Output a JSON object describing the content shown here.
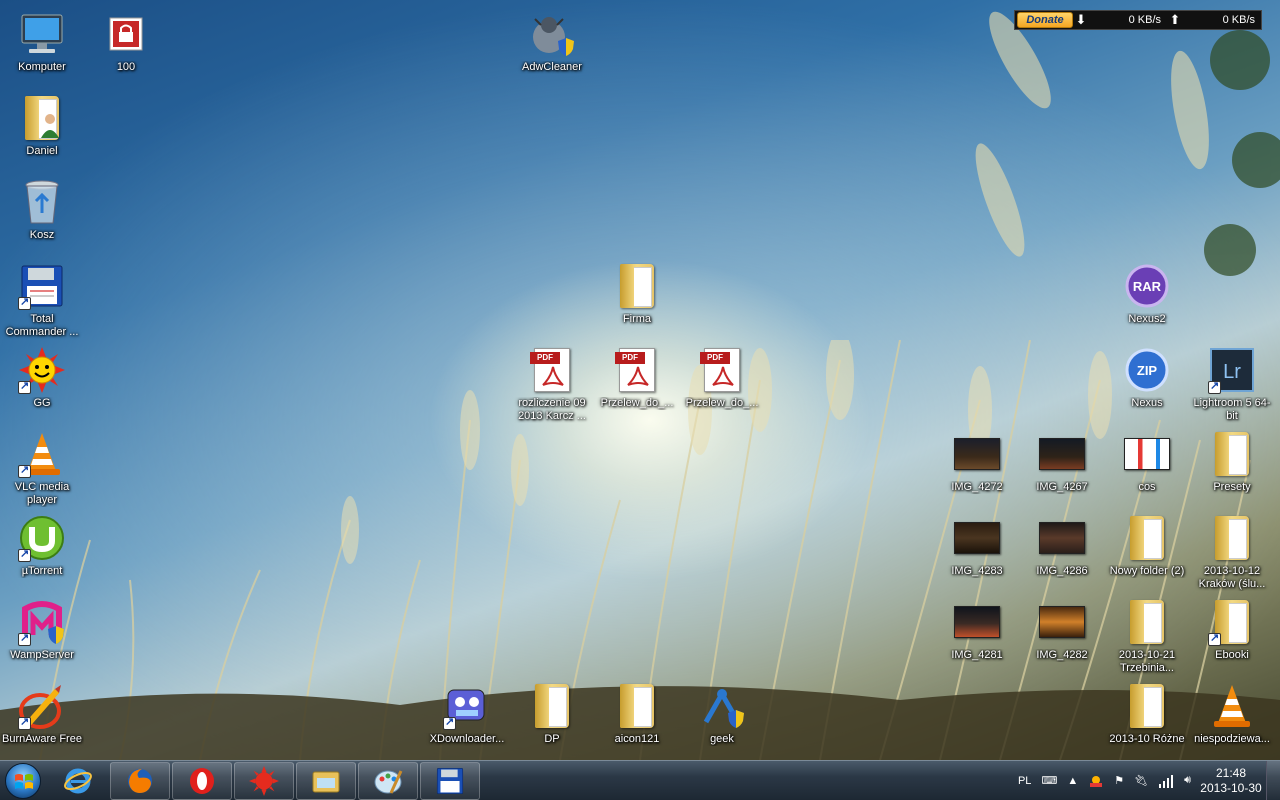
{
  "desktop": {
    "icons": {
      "komputer": "Komputer",
      "hundred": "100",
      "adwcleaner": "AdwCleaner",
      "daniel": "Daniel",
      "kosz": "Kosz",
      "total_commander": "Total Commander ...",
      "firma": "Firma",
      "nexus2": "Nexus2",
      "gg": "GG",
      "pdf1": "rozliczenie 09 2013 Karcz ...",
      "pdf2": "Przelew_do_...",
      "pdf3": "Przelew_do_...",
      "nexus": "Nexus",
      "lightroom": "Lightroom 5 64-bit",
      "vlc": "VLC media player",
      "img_4272": "IMG_4272",
      "img_4267": "IMG_4267",
      "cos": "cos",
      "presety": "Presety",
      "utorrent": "µTorrent",
      "img_4283": "IMG_4283",
      "img_4286": "IMG_4286",
      "nowy_folder": "Nowy folder (2)",
      "krakow": "2013-10-12 Kraków (ślu...",
      "wampserver": "WampServer",
      "img_4281": "IMG_4281",
      "img_4282": "IMG_4282",
      "trzebinia": "2013-10-21 Trzebinia...",
      "ebooki": "Ebooki",
      "burnaware": "BurnAware Free",
      "xdownloader": "XDownloader...",
      "dp": "DP",
      "aicon": "aicon121",
      "geek": "geek",
      "rozne": "2013-10 Różne",
      "niespodzianka": "niespodziewa..."
    }
  },
  "netmeter": {
    "donate": "Donate",
    "down_rate": "0 KB/s",
    "up_rate": "0 KB/s"
  },
  "tray": {
    "language": "PL",
    "time": "21:48",
    "date": "2013-10-30"
  },
  "colors": {
    "accent_red": "#b81c1c",
    "taskbar": "#2b3846"
  }
}
